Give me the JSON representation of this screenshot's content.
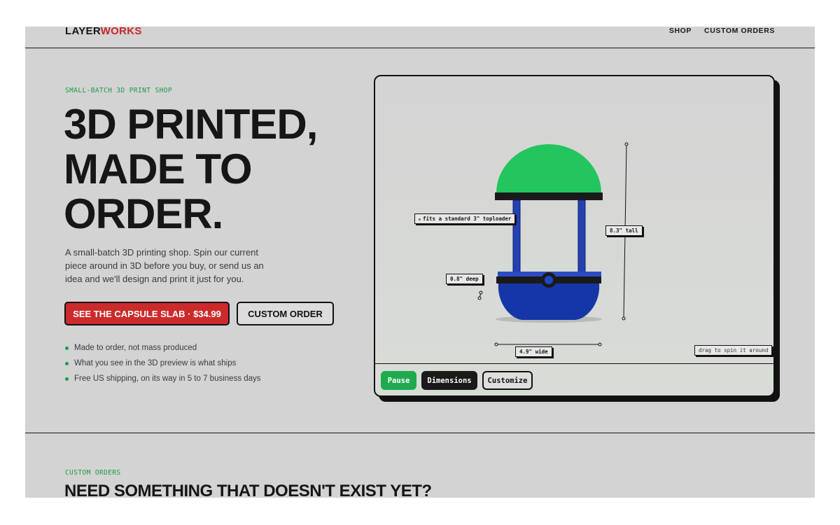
{
  "header": {
    "logo_part1": "LAYER",
    "logo_part2": "WORKS",
    "nav": [
      "SHOP",
      "CUSTOM ORDERS"
    ]
  },
  "hero": {
    "eyebrow": "SMALL-BATCH 3D PRINT SHOP",
    "title_lines": [
      "3D PRINTED,",
      "MADE TO",
      "ORDER."
    ],
    "description": "A small-batch 3D printing shop. Spin our current piece around in 3D before you buy, or send us an idea and we'll design and print it just for you.",
    "primary_button": "SEE THE CAPSULE SLAB · $34.99",
    "secondary_button": "CUSTOM ORDER",
    "bullets": [
      "Made to order, not mass produced",
      "What you see in the 3D preview is what ships",
      "Free US shipping, on its way in 5 to 7 business days"
    ]
  },
  "viewer": {
    "annotations": {
      "toploader": "fits a standard 3\" toploader",
      "height": "8.3\" tall",
      "depth": "0.8\" deep",
      "width": "4.9\" wide"
    },
    "hint": "drag to spin it around",
    "controls": {
      "pause": "Pause",
      "dimensions": "Dimensions",
      "customize": "Customize"
    },
    "colors": {
      "dome": "#22c55e",
      "base": "#1536a6",
      "band": "#1a1a1a"
    }
  },
  "custom_section": {
    "eyebrow": "CUSTOM ORDERS",
    "title": "NEED SOMETHING THAT DOESN'T EXIST YET?"
  }
}
